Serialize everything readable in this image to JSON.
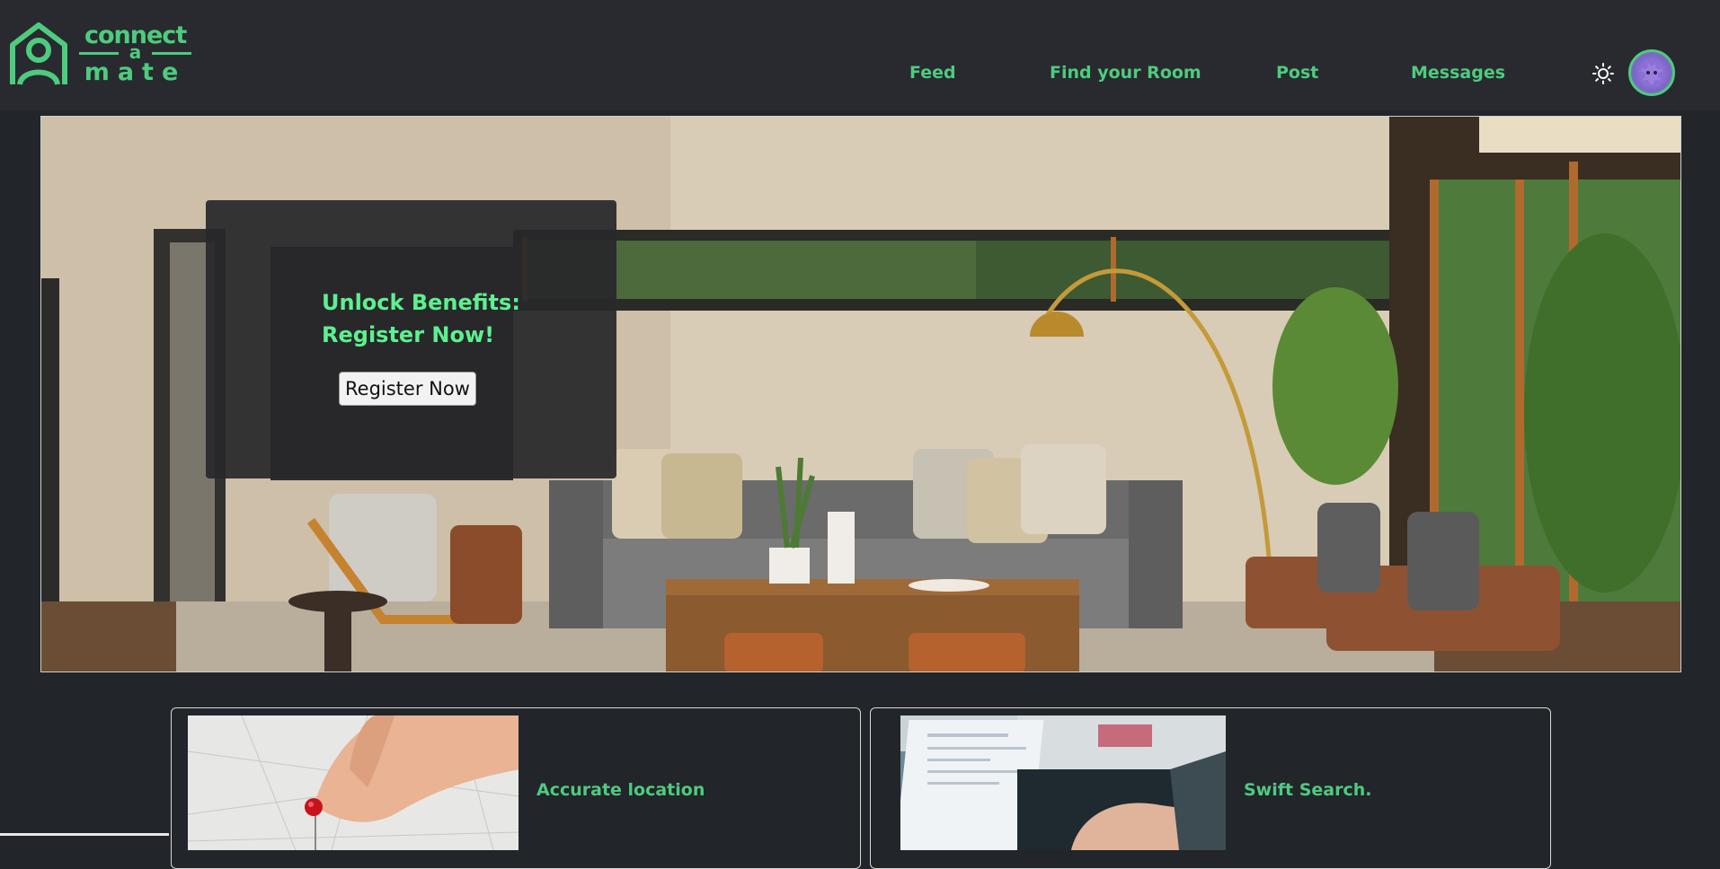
{
  "brand": {
    "line1": "connect",
    "line2": "a",
    "line3": "mate",
    "color": "#4ecb7e"
  },
  "nav": {
    "items": [
      {
        "label": "Feed"
      },
      {
        "label": "Find your Room"
      },
      {
        "label": "Post"
      },
      {
        "label": "Messages"
      }
    ],
    "theme_icon": "sun-icon",
    "avatar_icon": "avatar"
  },
  "hero": {
    "title_line1": "Unlock Benefits:",
    "title_line2": "Register Now!",
    "button_label": "Register Now",
    "accent": "#5ef08f"
  },
  "features": [
    {
      "label": "Accurate location",
      "image": "map-pin-photo"
    },
    {
      "label": "Swift Search.",
      "image": "laptop-photo"
    }
  ]
}
